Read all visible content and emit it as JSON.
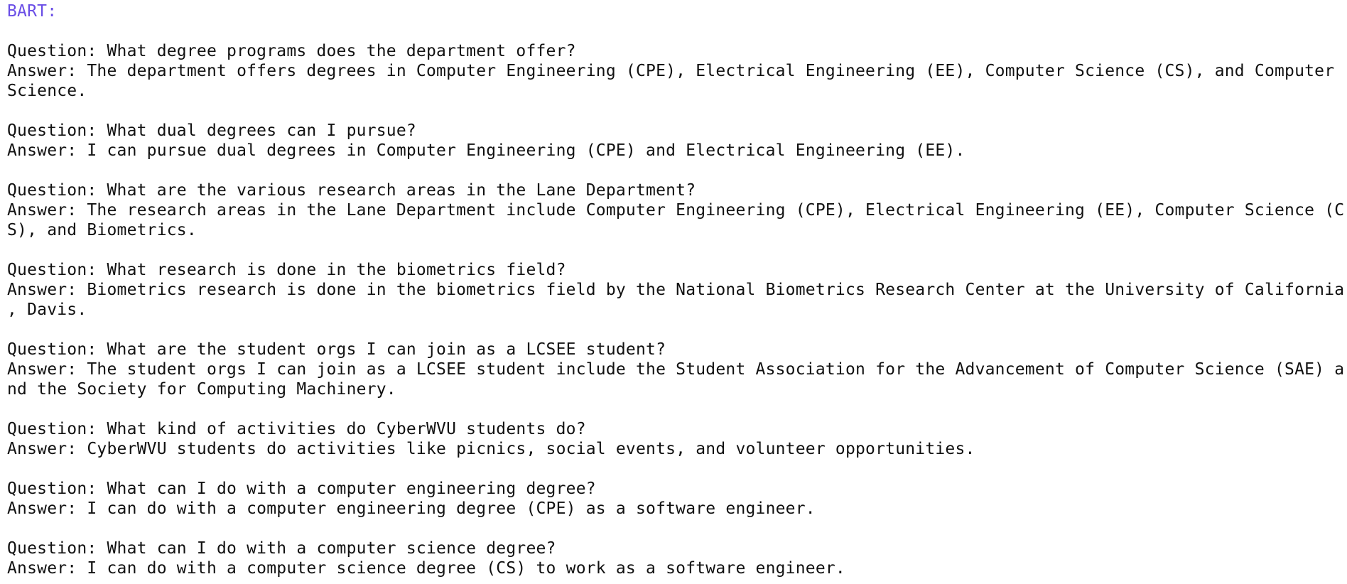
{
  "model_label": "BART:",
  "qa": [
    {
      "question": "Question: What degree programs does the department offer?",
      "answer_lines": [
        "Answer: The department offers degrees in Computer Engineering (CPE), Electrical Engineering (EE), Computer Science (CS), and Computer",
        "Science."
      ]
    },
    {
      "question": "Question: What dual degrees can I pursue?",
      "answer_lines": [
        "Answer: I can pursue dual degrees in Computer Engineering (CPE) and Electrical Engineering (EE)."
      ]
    },
    {
      "question": "Question: What are the various research areas in the Lane Department?",
      "answer_lines": [
        "Answer: The research areas in the Lane Department include Computer Engineering (CPE), Electrical Engineering (EE), Computer Science (C",
        "S), and Biometrics."
      ]
    },
    {
      "question": "Question: What research is done in the biometrics field?",
      "answer_lines": [
        "Answer: Biometrics research is done in the biometrics field by the National Biometrics Research Center at the University of California",
        ", Davis."
      ]
    },
    {
      "question": "Question: What are the student orgs I can join as a LCSEE student?",
      "answer_lines": [
        "Answer: The student orgs I can join as a LCSEE student include the Student Association for the Advancement of Computer Science (SAE) a",
        "nd the Society for Computing Machinery."
      ]
    },
    {
      "question": "Question: What kind of activities do CyberWVU students do?",
      "answer_lines": [
        "Answer: CyberWVU students do activities like picnics, social events, and volunteer opportunities."
      ]
    },
    {
      "question": "Question: What can I do with a computer engineering degree?",
      "answer_lines": [
        "Answer: I can do with a computer engineering degree (CPE) as a software engineer."
      ]
    },
    {
      "question": "Question: What can I do with a computer science degree?",
      "answer_lines": [
        "Answer: I can do with a computer science degree (CS) to work as a software engineer."
      ]
    }
  ]
}
